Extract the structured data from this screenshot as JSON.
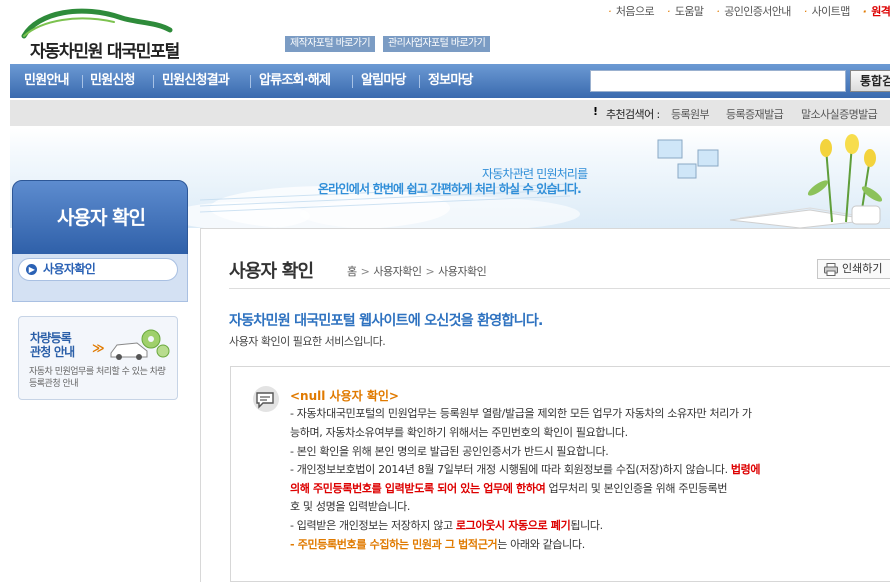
{
  "header": {
    "logo_text": "자동차민원 대국민포털",
    "quick_buttons": [
      "제작자포털 바로가기",
      "관리사업자포털 바로가기"
    ],
    "utility_links": [
      "처음으로",
      "도움말",
      "공인인증서안내",
      "사이트맵",
      "원격"
    ]
  },
  "nav": {
    "items": [
      "민원안내",
      "민원신청",
      "민원신청결과",
      "압류조회·해제",
      "알림마당",
      "정보마당"
    ],
    "search_placeholder": "",
    "search_button": "통합검"
  },
  "recommend": {
    "mark": "!",
    "title": "추천검색어 :",
    "keywords": [
      "등록원부",
      "등록증재발급",
      "말소사실증명발급"
    ]
  },
  "banner": {
    "line1": "자동차관련 민원처리를",
    "line2": "온라인에서 한번에 쉽고 간편하게 처리 하실 수 있습니다."
  },
  "sidebar": {
    "title": "사용자 확인",
    "active_item": "사용자확인",
    "promo_line1": "차량등록",
    "promo_line2": "관청 안내",
    "promo_arrows": "≫",
    "promo_desc": "자동차 민원업무를 처리할 수 있는 차량등록관청 안내"
  },
  "main": {
    "page_title": "사용자 확인",
    "breadcrumb": [
      "홈",
      "사용자확인",
      "사용자확인"
    ],
    "print_label": "인쇄하기",
    "welcome": "자동차민원 대국민포털 웹사이트에 오신것을 환영합니다.",
    "subtitle": "사용자 확인이 필요한 서비스입니다."
  },
  "notice": {
    "heading": "<null 사용자 확인>",
    "l1": "- 자동차대국민포털의 민원업무는 등록원부 열람/발급을 제외한 모든 업무가 자동차의 소유자만 처리가 가",
    "l2": "능하며, 자동차소유여부를 확인하기 위해서는 주민번호의 확인이 필요합니다.",
    "l3": "- 본인 확인을 위해 본인 명의로 발급된 공인인증서가 반드시 필요합니다.",
    "l4a": "- 개인정보보호법이 2014년 8월 7일부터 개정 시행됨에 따라 회원정보를 수집(저장)하지 않습니다. ",
    "l4b": "법령에",
    "l5a": "의해 주민등록번호를 입력받도록 되어 있는 업무에 한하여",
    "l5b": " 업무처리 및 본인인증을 위해 주민등록번",
    "l6": "호 및 성명을 입력받습니다.",
    "l7a": "- 입력받은 개인정보는 저장하지 않고 ",
    "l7b": "로그아웃시 자동으로 폐기",
    "l7c": "됩니다.",
    "l8a": "- 주민등록번호를 수집하는 민원과 그 법적근거",
    "l8b": "는 아래와 같습니다."
  },
  "colors": {
    "nav_top": "#6c9ad4",
    "nav_bottom": "#3a6aae",
    "accent_blue": "#2e72c0",
    "accent_orange": "#e07a00",
    "alert_red": "#d00000"
  }
}
